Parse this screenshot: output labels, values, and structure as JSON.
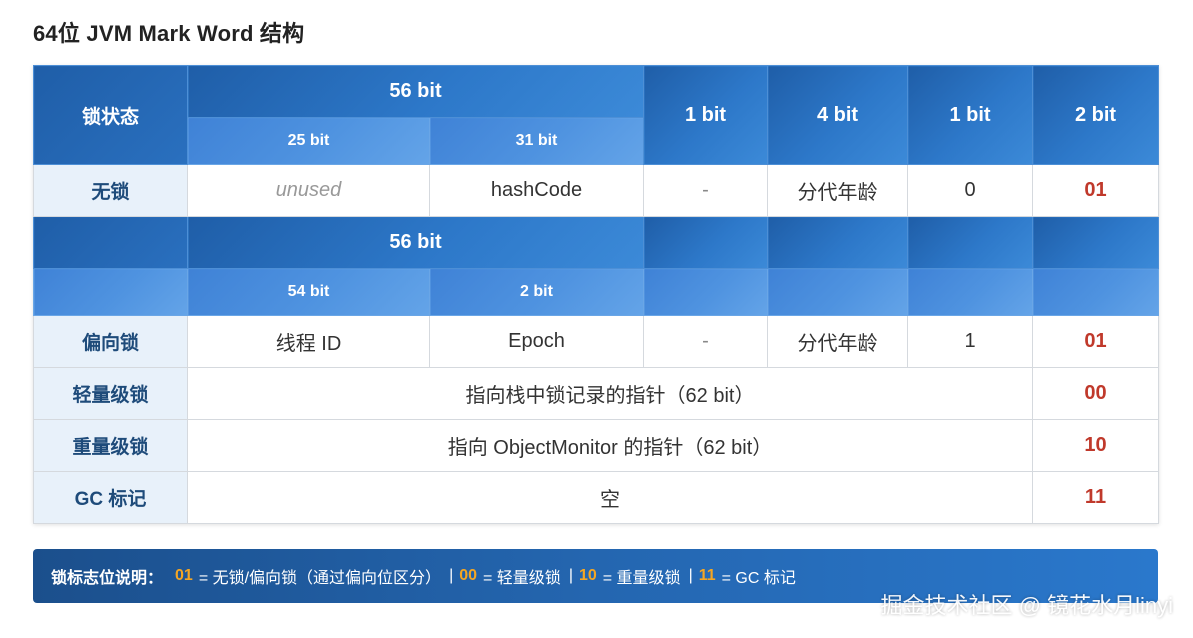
{
  "title": "64位 JVM Mark Word 结构",
  "table": {
    "header": {
      "state": "锁状态",
      "bits56": "56 bit",
      "bits25": "25 bit",
      "bits31": "31 bit",
      "bit1a": "1 bit",
      "bits4": "4 bit",
      "bit1b": "1 bit",
      "bits2": "2 bit"
    },
    "unlocked": {
      "label": "无锁",
      "unused": "unused",
      "hash": "hashCode",
      "dash": "-",
      "age": "分代年龄",
      "biased": "0",
      "flag": "01"
    },
    "header2": {
      "bits56": "56 bit",
      "bits54": "54 bit",
      "bits2": "2 bit"
    },
    "biased": {
      "label": "偏向锁",
      "thread": "线程 ID",
      "epoch": "Epoch",
      "dash": "-",
      "age": "分代年龄",
      "biased": "1",
      "flag": "01"
    },
    "lightweight": {
      "label": "轻量级锁",
      "content": "指向栈中锁记录的指针（62 bit）",
      "flag": "00"
    },
    "heavyweight": {
      "label": "重量级锁",
      "content": "指向 ObjectMonitor 的指针（62 bit）",
      "flag": "10"
    },
    "gc": {
      "label": "GC 标记",
      "content": "空",
      "flag": "11"
    }
  },
  "legend": {
    "title": "锁标志位说明：",
    "items": [
      {
        "code": "01",
        "text": "= 无锁/偏向锁（通过偏向位区分）"
      },
      {
        "code": "00",
        "text": "= 轻量级锁"
      },
      {
        "code": "10",
        "text": "= 重量级锁"
      },
      {
        "code": "11",
        "text": "= GC 标记"
      }
    ],
    "separator": "|"
  },
  "watermark": "掘金技术社区 @ 镜花水月linyi",
  "colors": {
    "header_blue": "#2d78c9",
    "subheader_blue": "#4f93e0",
    "label_bg": "#e8f1fa",
    "flag_red": "#c0392b",
    "legend_code_orange": "#f5a623"
  }
}
